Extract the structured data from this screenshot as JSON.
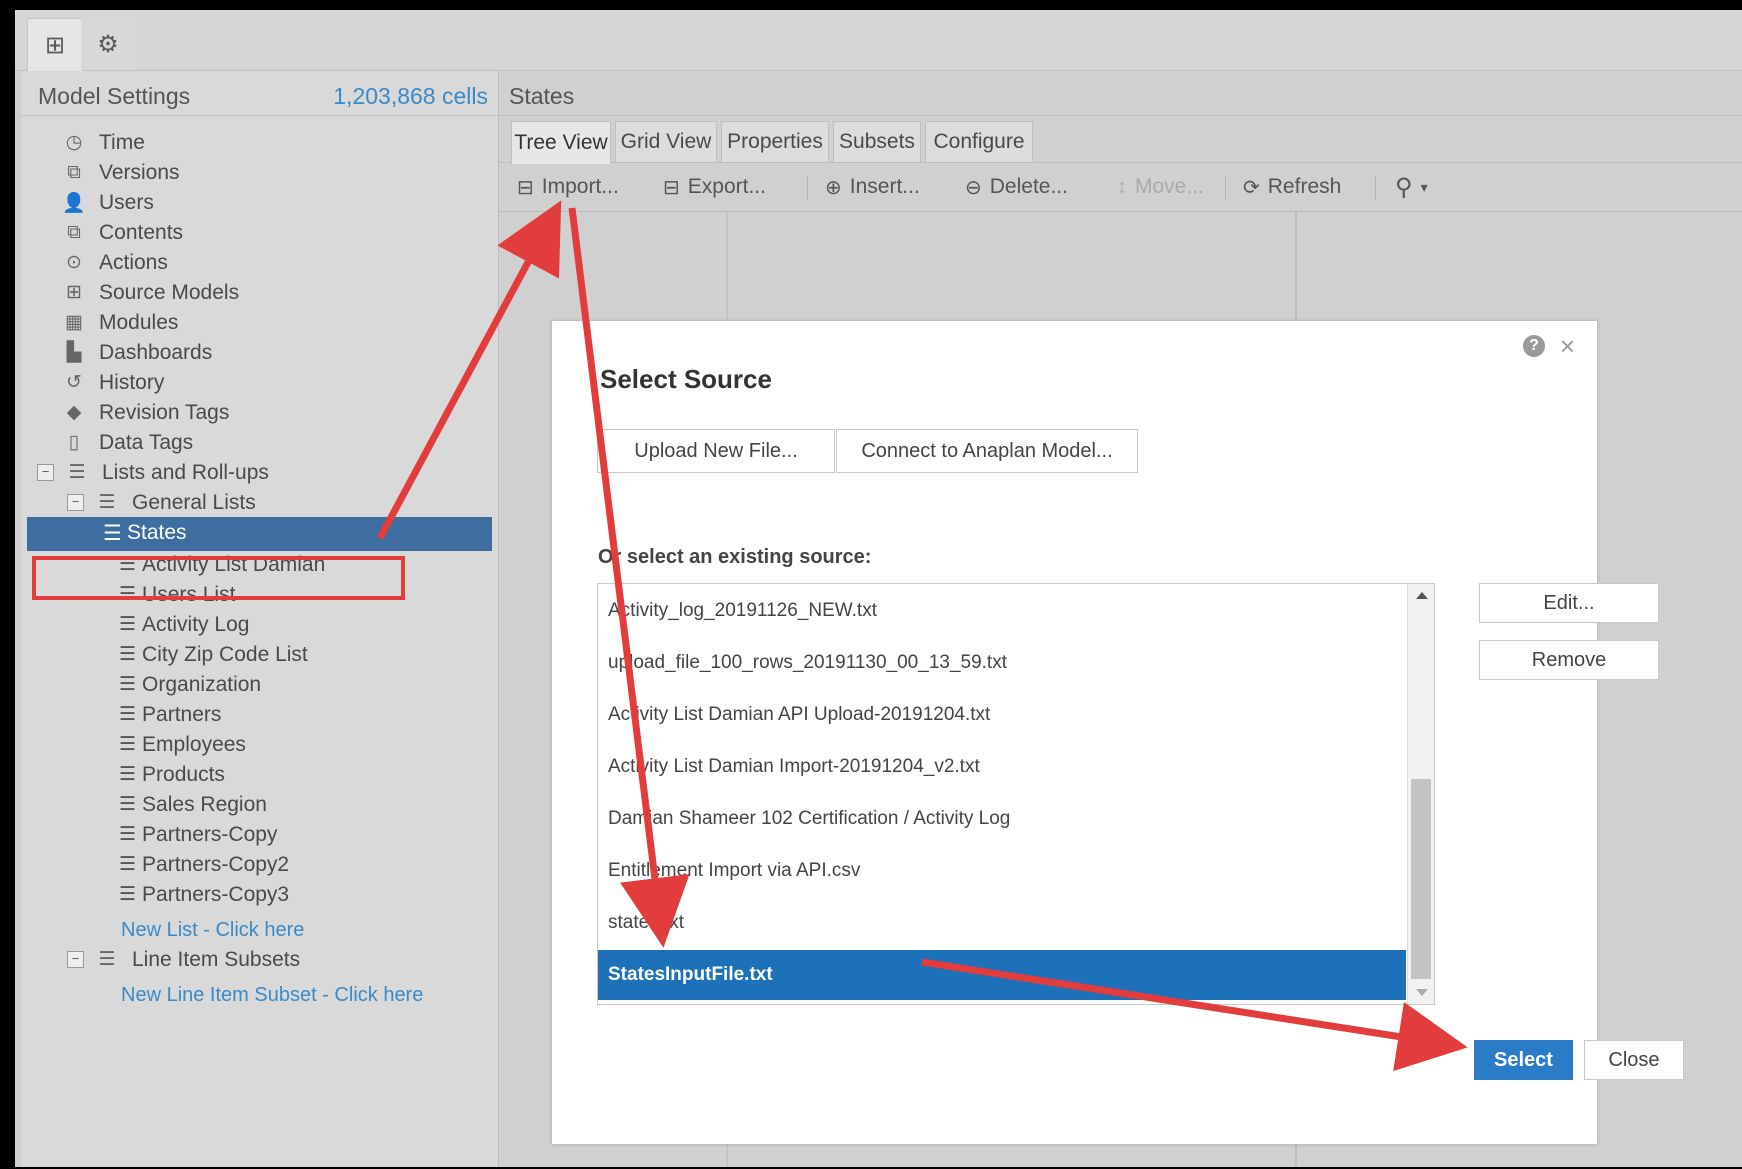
{
  "top_tabs": [
    {
      "icon": "model-tree-icon",
      "glyph": "⊞"
    },
    {
      "icon": "gear-icon",
      "glyph": "⚙"
    }
  ],
  "sidebar": {
    "title": "Model Settings",
    "cells": "1,203,868 cells",
    "items": [
      {
        "label": "Time",
        "icon": "clock-icon",
        "glyph": "◷"
      },
      {
        "label": "Versions",
        "icon": "versions-icon",
        "glyph": "⧉"
      },
      {
        "label": "Users",
        "icon": "user-icon",
        "glyph": "👤"
      },
      {
        "label": "Contents",
        "icon": "contents-icon",
        "glyph": "⧉"
      },
      {
        "label": "Actions",
        "icon": "play-circle-icon",
        "glyph": "⊙"
      },
      {
        "label": "Source Models",
        "icon": "source-models-icon",
        "glyph": "⊞"
      },
      {
        "label": "Modules",
        "icon": "grid-icon",
        "glyph": "▦"
      },
      {
        "label": "Dashboards",
        "icon": "dashboard-icon",
        "glyph": "▙"
      },
      {
        "label": "History",
        "icon": "history-icon",
        "glyph": "↺"
      },
      {
        "label": "Revision Tags",
        "icon": "tag-icon",
        "glyph": "◆"
      },
      {
        "label": "Data Tags",
        "icon": "data-tag-icon",
        "glyph": "▯"
      },
      {
        "label": "Lists and Roll-ups",
        "icon": "list-icon",
        "glyph": "☰"
      }
    ],
    "general_lists_label": "General Lists",
    "lists": [
      "States",
      "Activity List Damian",
      "Users List",
      "Activity Log",
      "City Zip Code List",
      "Organization",
      "Partners",
      "Employees",
      "Products",
      "Sales Region",
      "Partners-Copy",
      "Partners-Copy2",
      "Partners-Copy3"
    ],
    "new_list_link": "New List - Click here",
    "line_item_subsets_label": "Line Item Subsets",
    "new_line_item_subset_link": "New Line Item Subset - Click here"
  },
  "main": {
    "title": "States",
    "tabs": [
      "Tree View",
      "Grid View",
      "Properties",
      "Subsets",
      "Configure"
    ],
    "toolbar": {
      "import": "Import...",
      "export": "Export...",
      "insert": "Insert...",
      "delete": "Delete...",
      "move": "Move...",
      "refresh": "Refresh"
    }
  },
  "modal": {
    "title": "Select Source",
    "help": "?",
    "close": "×",
    "upload_button": "Upload New File...",
    "connect_button": "Connect to Anaplan Model...",
    "existing_label": "Or select an existing source:",
    "sources": [
      "Activity_log_20191126_NEW.txt",
      "upload_file_100_rows_20191130_00_13_59.txt",
      "Activity List Damian API Upload-20191204.txt",
      "Activity List Damian Import-20191204_v2.txt",
      "Damian Shameer 102 Certification / Activity Log",
      "Entitlement Import via API.csv",
      "states.txt",
      "StatesInputFile.txt"
    ],
    "selected_source": "StatesInputFile.txt",
    "edit_button": "Edit...",
    "remove_button": "Remove",
    "select_button": "Select",
    "close_button": "Close"
  },
  "colors": {
    "accent": "#2a7cc7",
    "selected_row": "#1d71b8",
    "sidebar_selected": "#3d6e9f",
    "annotation": "#e23c3c",
    "link": "#3a8ac7"
  }
}
